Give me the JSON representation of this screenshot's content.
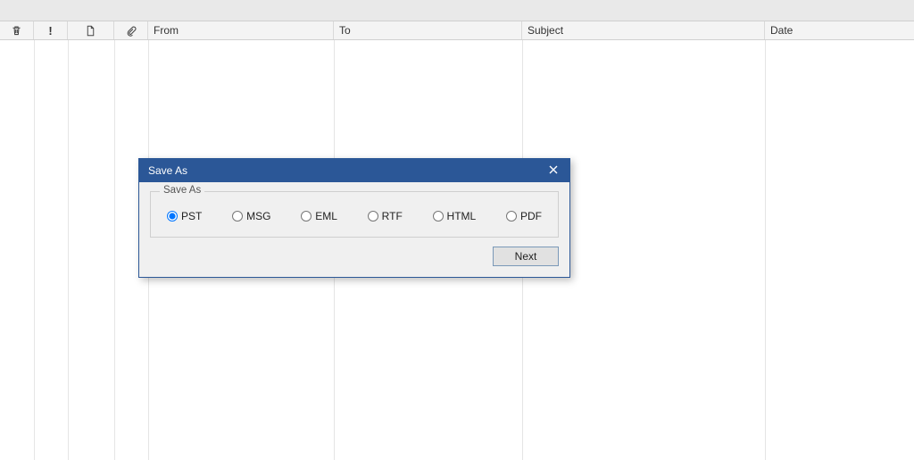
{
  "columns": {
    "from": "From",
    "to": "To",
    "subject": "Subject",
    "date": "Date"
  },
  "dialog": {
    "title": "Save As",
    "group_label": "Save As",
    "options": {
      "pst": "PST",
      "msg": "MSG",
      "eml": "EML",
      "rtf": "RTF",
      "html": "HTML",
      "pdf": "PDF"
    },
    "selected": "pst",
    "next_label": "Next"
  }
}
